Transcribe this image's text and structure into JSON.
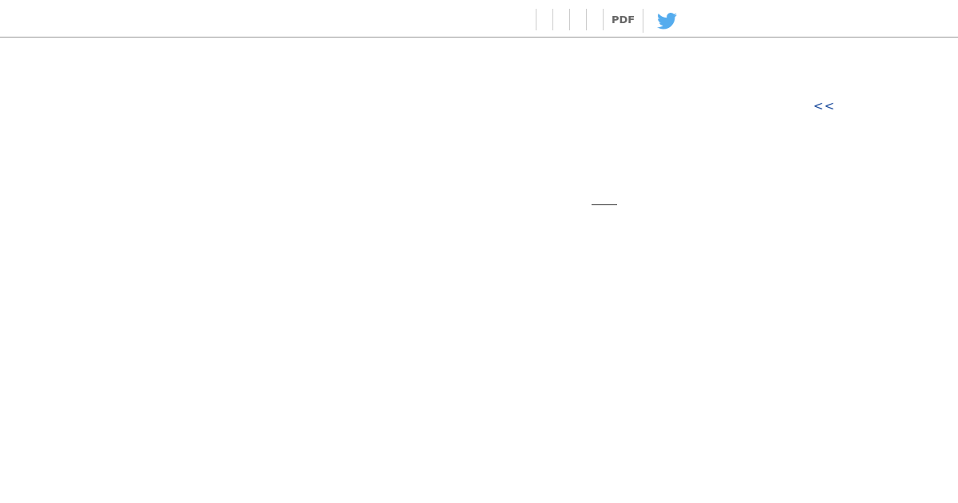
{
  "toolbar": {
    "pdf_link": "PDF"
  },
  "navigation": {
    "back_link": "<<"
  }
}
